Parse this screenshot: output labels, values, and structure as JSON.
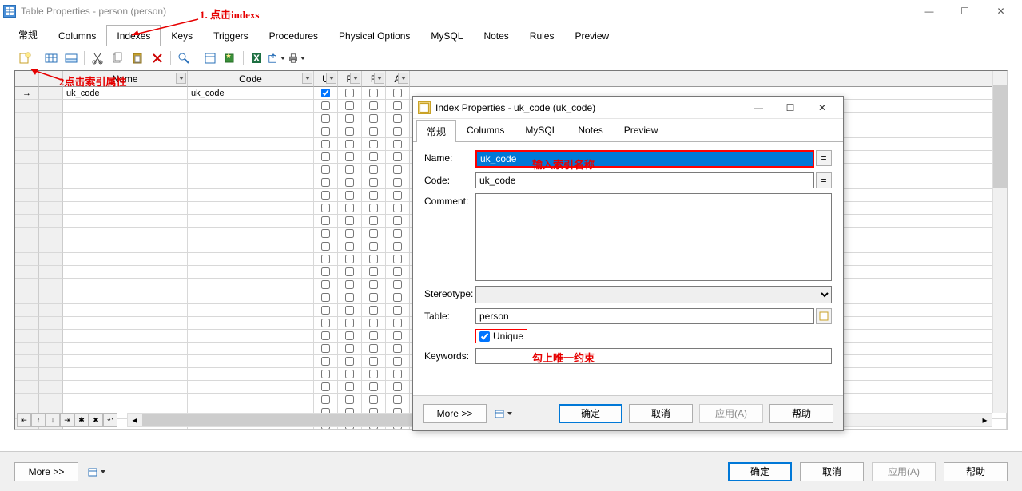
{
  "main_window": {
    "title": "Table Properties - person (person)",
    "tabs": [
      "常规",
      "Columns",
      "Indexes",
      "Keys",
      "Triggers",
      "Procedures",
      "Physical Options",
      "MySQL",
      "Notes",
      "Rules",
      "Preview"
    ],
    "active_tab_index": 2
  },
  "toolbar_icons": [
    "new",
    "relation-table",
    "table2",
    "cut",
    "copy",
    "paste",
    "delete",
    "find",
    "wand",
    "excel",
    "export",
    "print"
  ],
  "grid": {
    "columns": [
      "",
      "",
      "Name",
      "Code",
      "U",
      "P",
      "F",
      "A",
      ""
    ],
    "rows": [
      {
        "name": "uk_code",
        "code": "uk_code",
        "u": true,
        "p": false,
        "f": false,
        "a": false
      }
    ],
    "empty_row_count": 26,
    "nav_buttons": [
      "⇤",
      "↑",
      "↓",
      "⇥",
      "✱",
      "✖",
      "↶"
    ]
  },
  "main_buttons": {
    "more": "More >>",
    "ok": "确定",
    "cancel": "取消",
    "apply": "应用(A)",
    "help": "帮助"
  },
  "dialog": {
    "title": "Index Properties - uk_code (uk_code)",
    "tabs": [
      "常规",
      "Columns",
      "MySQL",
      "Notes",
      "Preview"
    ],
    "active_tab_index": 0,
    "labels": {
      "name": "Name:",
      "code": "Code:",
      "comment": "Comment:",
      "stereotype": "Stereotype:",
      "table": "Table:",
      "unique": "Unique",
      "keywords": "Keywords:"
    },
    "values": {
      "name": "uk_code",
      "code": "uk_code",
      "comment": "",
      "stereotype": "",
      "table": "person",
      "unique": true,
      "keywords": ""
    },
    "buttons": {
      "more": "More >>",
      "ok": "确定",
      "cancel": "取消",
      "apply": "应用(A)",
      "help": "帮助"
    }
  },
  "annotations": {
    "a1": "1. 点击indexs",
    "a2": "2点击索引属性",
    "a3": "输入索引名称",
    "a4": "勾上唯一约束"
  }
}
